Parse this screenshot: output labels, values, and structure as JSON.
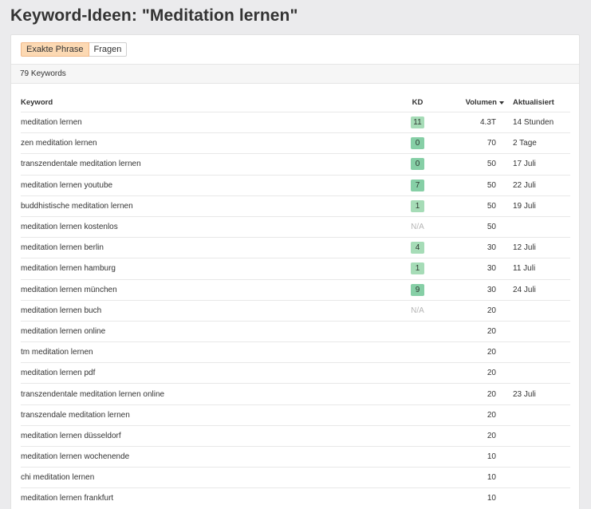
{
  "page": {
    "title": "Keyword-Ideen: \"Meditation lernen\""
  },
  "tabs": [
    {
      "label": "Exakte Phrase",
      "active": true
    },
    {
      "label": "Fragen",
      "active": false
    }
  ],
  "summary": {
    "count_label": "79 Keywords"
  },
  "table": {
    "headers": {
      "keyword": "Keyword",
      "kd": "KD",
      "volume": "Volumen",
      "updated": "Aktualisiert"
    },
    "sort_icon": "caret-down-icon",
    "badge_colors": {
      "light": "#a6dcb7",
      "medium": "#86cfa6"
    },
    "rows": [
      {
        "keyword": "meditation lernen",
        "kd": "11",
        "volume": "4.3T",
        "updated": "14 Stunden"
      },
      {
        "keyword": "zen meditation lernen",
        "kd": "0",
        "volume": "70",
        "updated": "2 Tage"
      },
      {
        "keyword": "transzendentale meditation lernen",
        "kd": "0",
        "volume": "50",
        "updated": "17 Juli"
      },
      {
        "keyword": "meditation lernen youtube",
        "kd": "7",
        "volume": "50",
        "updated": "22 Juli"
      },
      {
        "keyword": "buddhistische meditation lernen",
        "kd": "1",
        "volume": "50",
        "updated": "19 Juli"
      },
      {
        "keyword": "meditation lernen kostenlos",
        "kd": "N/A",
        "volume": "50",
        "updated": ""
      },
      {
        "keyword": "meditation lernen berlin",
        "kd": "4",
        "volume": "30",
        "updated": "12 Juli"
      },
      {
        "keyword": "meditation lernen hamburg",
        "kd": "1",
        "volume": "30",
        "updated": "11 Juli"
      },
      {
        "keyword": "meditation lernen münchen",
        "kd": "9",
        "volume": "30",
        "updated": "24 Juli"
      },
      {
        "keyword": "meditation lernen buch",
        "kd": "N/A",
        "volume": "20",
        "updated": ""
      },
      {
        "keyword": "meditation lernen online",
        "kd": "",
        "volume": "20",
        "updated": ""
      },
      {
        "keyword": "tm meditation lernen",
        "kd": "",
        "volume": "20",
        "updated": ""
      },
      {
        "keyword": "meditation lernen pdf",
        "kd": "",
        "volume": "20",
        "updated": ""
      },
      {
        "keyword": "transzendentale meditation lernen online",
        "kd": "",
        "volume": "20",
        "updated": "23 Juli"
      },
      {
        "keyword": "transzendale meditation lernen",
        "kd": "",
        "volume": "20",
        "updated": ""
      },
      {
        "keyword": "meditation lernen düsseldorf",
        "kd": "",
        "volume": "20",
        "updated": ""
      },
      {
        "keyword": "meditation lernen wochenende",
        "kd": "",
        "volume": "10",
        "updated": ""
      },
      {
        "keyword": "chi meditation lernen",
        "kd": "",
        "volume": "10",
        "updated": ""
      },
      {
        "keyword": "meditation lernen frankfurt",
        "kd": "",
        "volume": "10",
        "updated": ""
      }
    ]
  }
}
